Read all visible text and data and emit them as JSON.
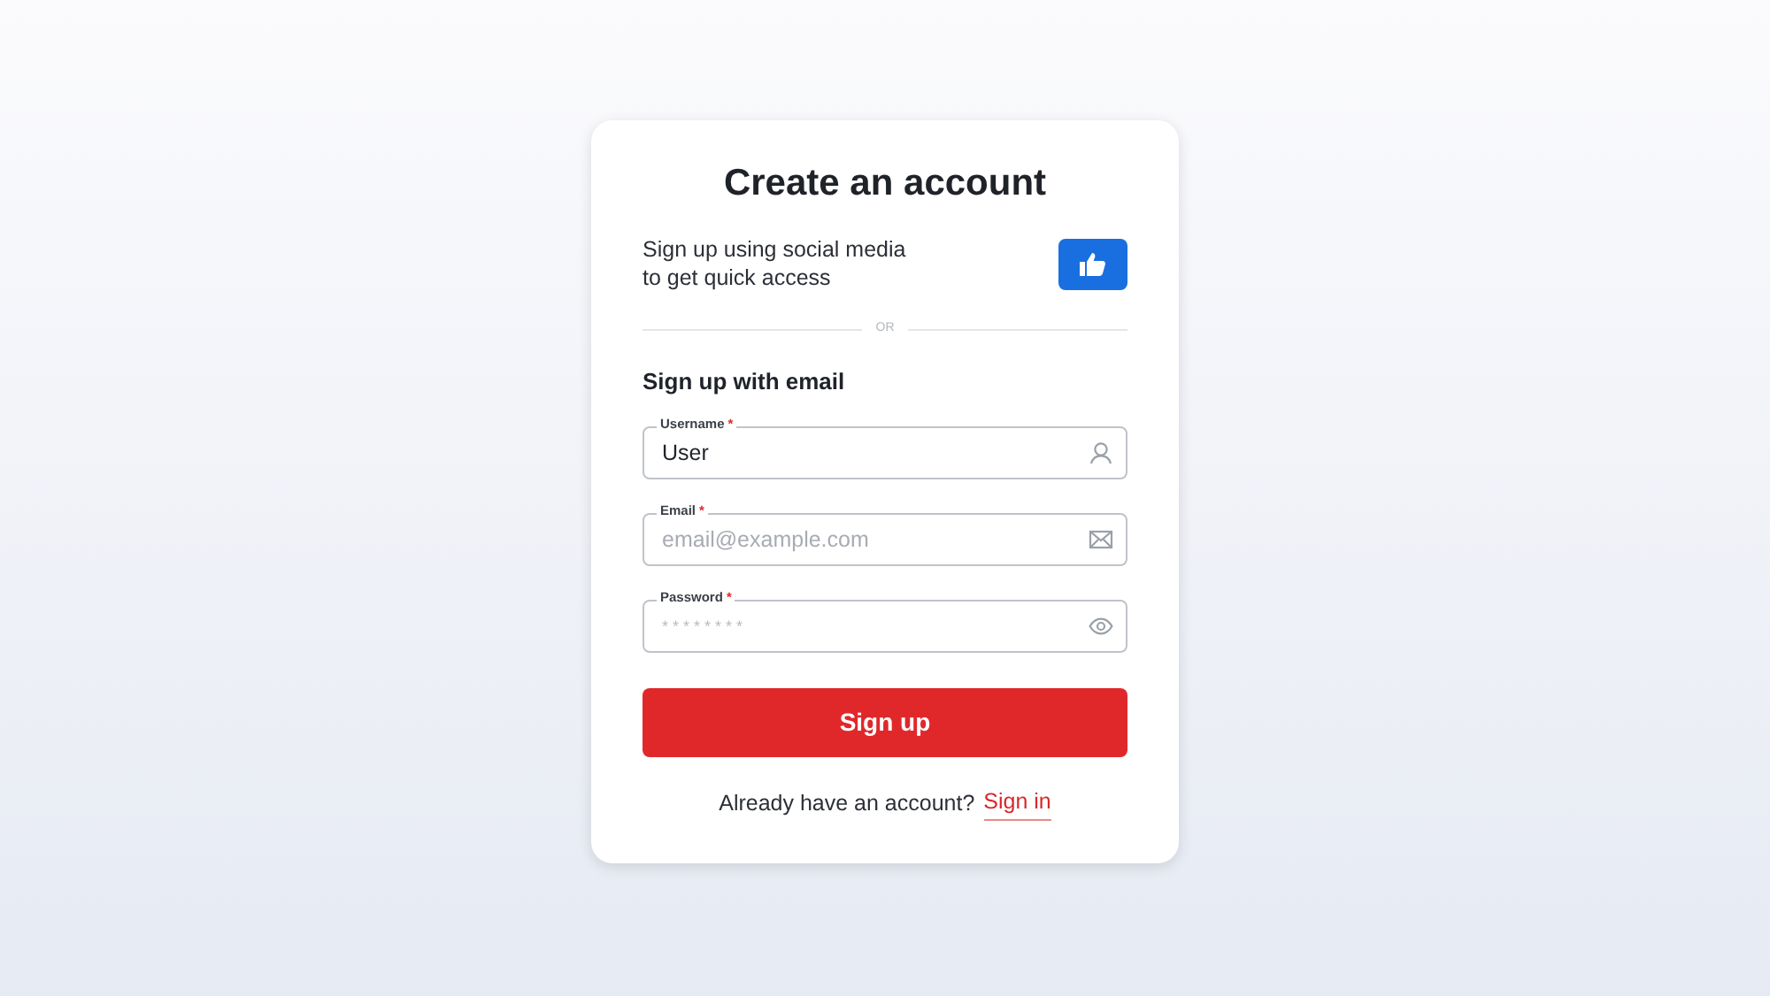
{
  "title": "Create an account",
  "social": {
    "text": "Sign up using social media\nto get quick access"
  },
  "divider": "OR",
  "section_heading": "Sign up with email",
  "fields": [
    {
      "kind": "user",
      "label": "Username",
      "required_mark": "*",
      "value": "User"
    },
    {
      "kind": "email",
      "label": "Email",
      "required_mark": "*",
      "placeholder": "email@example.com"
    },
    {
      "kind": "password",
      "label": "Password",
      "required_mark": "*",
      "placeholder": "* * * * * * * *"
    }
  ],
  "submit_button": "Sign up",
  "footer": {
    "text": "Already have an account?",
    "link": "Sign in"
  }
}
